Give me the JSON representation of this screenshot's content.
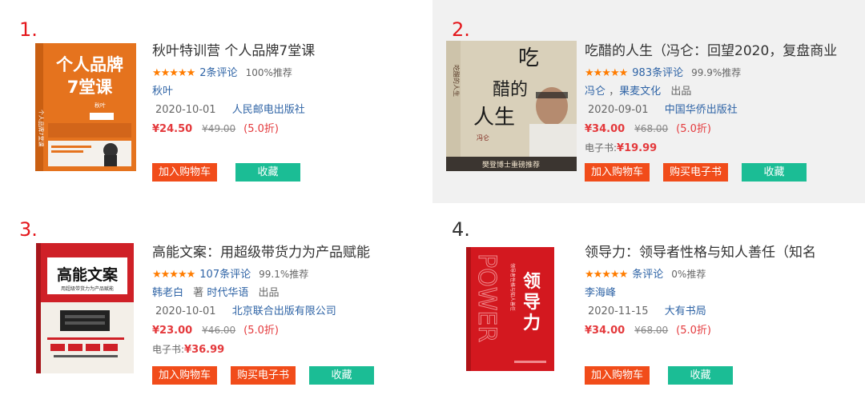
{
  "items": [
    {
      "rank": "1.",
      "title": "秋叶特训营 个人品牌7堂课",
      "stars": "★★★★★",
      "reviews": "2条评论",
      "recommend": "100%推荐",
      "author": "秋叶",
      "date": "2020-10-01",
      "publisher": "人民邮电出版社",
      "price": "¥24.50",
      "original_price": "¥49.00",
      "discount": "(5.0折)",
      "cover": {
        "title_line1": "个人品牌",
        "title_line2": "7堂课",
        "side_text": "个人品牌7堂课",
        "author_text": "秋叶",
        "bg": "#e5731e",
        "accent": "#ffffff"
      },
      "buttons": {
        "cart": "加入购物车",
        "fav": "收藏"
      }
    },
    {
      "rank": "2.",
      "title": "吃醋的人生（冯仑：回望2020，复盘商业",
      "stars": "★★★★★",
      "reviews": "983条评论",
      "recommend": "99.9%推荐",
      "author": "冯仑",
      "author_sep": "，",
      "author2": "果麦文化",
      "produced": "出品",
      "date": "2020-09-01",
      "publisher": "中国华侨出版社",
      "price": "¥34.00",
      "original_price": "¥68.00",
      "discount": "(5.0折)",
      "ebook_label": "电子书:",
      "ebook_price": "¥19.99",
      "cover": {
        "big1": "吃",
        "big2": "醋的",
        "big3": "人生",
        "author_text": "冯仑",
        "side_text": "吃醋的人生",
        "band": "樊登博士重磅推荐",
        "bg": "#d8cfb8",
        "band_bg": "#3b3530"
      },
      "buttons": {
        "cart": "加入购物车",
        "buy": "购买电子书",
        "fav": "收藏"
      }
    },
    {
      "rank": "3.",
      "title": "高能文案：用超级带货力为产品赋能",
      "stars": "★★★★★",
      "reviews": "107条评论",
      "recommend": "99.1%推荐",
      "author": "韩老白",
      "author_role": "著",
      "author2": "时代华语",
      "produced": "出品",
      "date": "2020-10-01",
      "publisher": "北京联合出版有限公司",
      "price": "¥23.00",
      "original_price": "¥46.00",
      "discount": "(5.0折)",
      "ebook_label": "电子书:",
      "ebook_price": "¥36.99",
      "cover": {
        "title": "高能文案",
        "subtitle": "用超级带货力为产品赋能",
        "bg": "#cf2027",
        "paper": "#f3efe8"
      },
      "buttons": {
        "cart": "加入购物车",
        "buy": "购买电子书",
        "fav": "收藏"
      }
    },
    {
      "rank": "4.",
      "title": "领导力：领导者性格与知人善任（知名",
      "stars": "★★★★★",
      "reviews": "条评论",
      "recommend": "0%推荐",
      "author": "李海峰",
      "date": "2020-11-15",
      "publisher": "大有书局",
      "price": "¥34.00",
      "original_price": "¥68.00",
      "discount": "(5.0折)",
      "cover": {
        "title": "领导力",
        "outline": "POWER",
        "subtitle": "领导者性格与知人善任",
        "bg": "#d3181f"
      },
      "buttons": {
        "cart": "加入购物车",
        "fav": "收藏"
      }
    }
  ]
}
